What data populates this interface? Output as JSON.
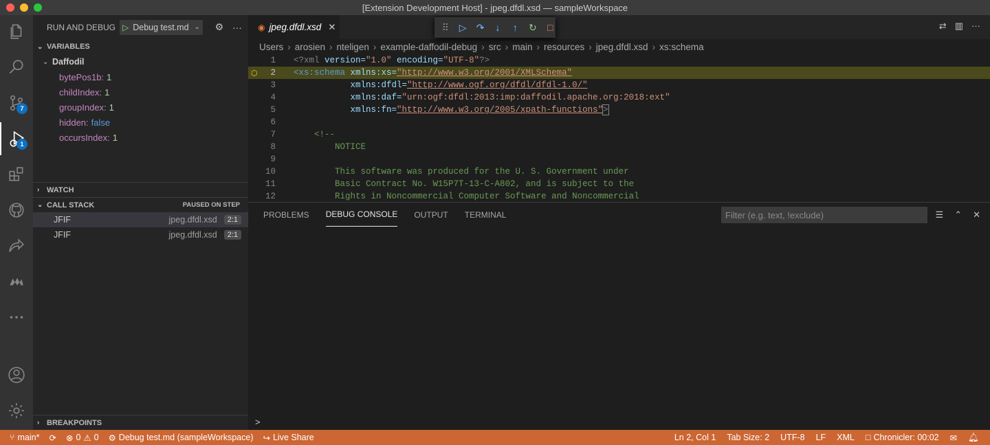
{
  "window": {
    "title": "[Extension Development Host] - jpeg.dfdl.xsd — sampleWorkspace"
  },
  "activity_bar": {
    "scm_badge": "7",
    "debug_badge": "1"
  },
  "sidebar": {
    "title": "RUN AND DEBUG",
    "config_name": "Debug test.md",
    "variables_header": "VARIABLES",
    "scope": "Daffodil",
    "variables": [
      {
        "name": "bytePos1b:",
        "value": "1",
        "type": "number"
      },
      {
        "name": "childIndex:",
        "value": "1",
        "type": "number"
      },
      {
        "name": "groupIndex:",
        "value": "1",
        "type": "number"
      },
      {
        "name": "hidden:",
        "value": "false",
        "type": "bool"
      },
      {
        "name": "occursIndex:",
        "value": "1",
        "type": "number"
      }
    ],
    "watch_header": "WATCH",
    "callstack_header": "CALL STACK",
    "callstack_status": "PAUSED ON STEP",
    "stack": [
      {
        "fn": "JFIF",
        "file": "jpeg.dfdl.xsd",
        "pos": "2:1"
      },
      {
        "fn": "JFIF",
        "file": "jpeg.dfdl.xsd",
        "pos": "2:1"
      }
    ],
    "breakpoints_header": "BREAKPOINTS"
  },
  "editor": {
    "tab_label": "jpeg.dfdl.xsd",
    "breadcrumb": [
      "Users",
      "arosien",
      "nteligen",
      "example-daffodil-debug",
      "src",
      "main",
      "resources",
      "jpeg.dfdl.xsd",
      "xs:schema"
    ],
    "lines": [
      "1",
      "2",
      "3",
      "4",
      "5",
      "6",
      "7",
      "8",
      "9",
      "10",
      "11",
      "12"
    ],
    "code": {
      "l1_a": "<?xml ",
      "l1_b": "version=",
      "l1_c": "\"1.0\"",
      "l1_d": " encoding=",
      "l1_e": "\"UTF-8\"",
      "l1_f": "?>",
      "l2_tag": "<xs:schema",
      "l2_attr": " xmlns:xs=",
      "l2_val": "\"http://www.w3.org/2001/XMLSchema\"",
      "l3_attr": "xmlns:dfdl=",
      "l3_val": "\"http://www.ogf.org/dfdl/dfdl-1.0/\"",
      "l4_attr": "xmlns:daf=",
      "l4_val": "\"urn:ogf:dfdl:2013:imp:daffodil.apache.org:2018:ext\"",
      "l5_attr": "xmlns:fn=",
      "l5_val": "\"http://www.w3.org/2005/xpath-functions\"",
      "l5_end": ">",
      "l7": "<!--",
      "l8": "NOTICE",
      "l10": "This software was produced for the U. S. Government under",
      "l11": "Basic Contract No. W15P7T-13-C-A802, and is subject to the",
      "l12": "Rights in Noncommercial Computer Software and Noncommercial"
    }
  },
  "panel": {
    "tabs": [
      "PROBLEMS",
      "DEBUG CONSOLE",
      "OUTPUT",
      "TERMINAL"
    ],
    "active_tab": "DEBUG CONSOLE",
    "filter_placeholder": "Filter (e.g. text, !exclude)",
    "prompt": ">"
  },
  "statusbar": {
    "branch": "main*",
    "errors": "0",
    "warnings": "0",
    "debug_target": "Debug test.md (sampleWorkspace)",
    "live_share": "Live Share",
    "position": "Ln 2, Col 1",
    "tab_size": "Tab Size: 2",
    "encoding": "UTF-8",
    "eol": "LF",
    "language": "XML",
    "chronicler": "Chronicler: 00:02"
  },
  "colors": {
    "status_bar": "#cc6633",
    "current_line": "#4b4a1c",
    "accent": "#0e70c0"
  }
}
